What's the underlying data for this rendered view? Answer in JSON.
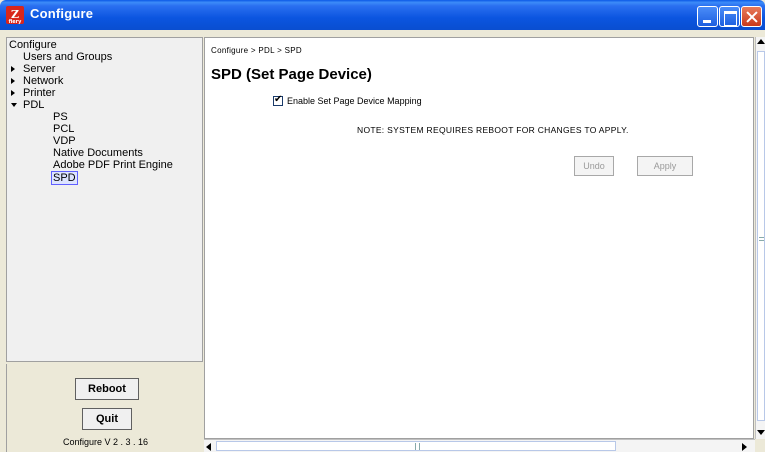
{
  "window": {
    "title": "Configure",
    "app_icon_glyph": "Z",
    "app_icon_small": "fiery"
  },
  "tree": {
    "root": "Configure",
    "items": [
      {
        "label": "Users and Groups",
        "arrow": ""
      },
      {
        "label": "Server",
        "arrow": "right"
      },
      {
        "label": "Network",
        "arrow": "right"
      },
      {
        "label": "Printer",
        "arrow": "right"
      },
      {
        "label": "PDL",
        "arrow": "down"
      }
    ],
    "pdl_children": [
      {
        "label": "PS"
      },
      {
        "label": "PCL"
      },
      {
        "label": "VDP"
      },
      {
        "label": "Native Documents"
      },
      {
        "label": "Adobe PDF Print Engine"
      },
      {
        "label": "SPD",
        "selected": true
      }
    ]
  },
  "left_footer": {
    "reboot_label": "Reboot",
    "quit_label": "Quit",
    "version": "Configure V 2 . 3 . 16"
  },
  "main": {
    "breadcrumb": "Configure > PDL > SPD",
    "title": "SPD (Set Page Device)",
    "checkbox_label": "Enable Set Page Device Mapping",
    "checkbox_checked": true,
    "note": "NOTE: SYSTEM REQUIRES REBOOT FOR CHANGES TO APPLY.",
    "undo_label": "Undo",
    "apply_label": "Apply"
  },
  "colors": {
    "titlebar": "#0a4ed0",
    "selection_border": "#6060ff"
  }
}
